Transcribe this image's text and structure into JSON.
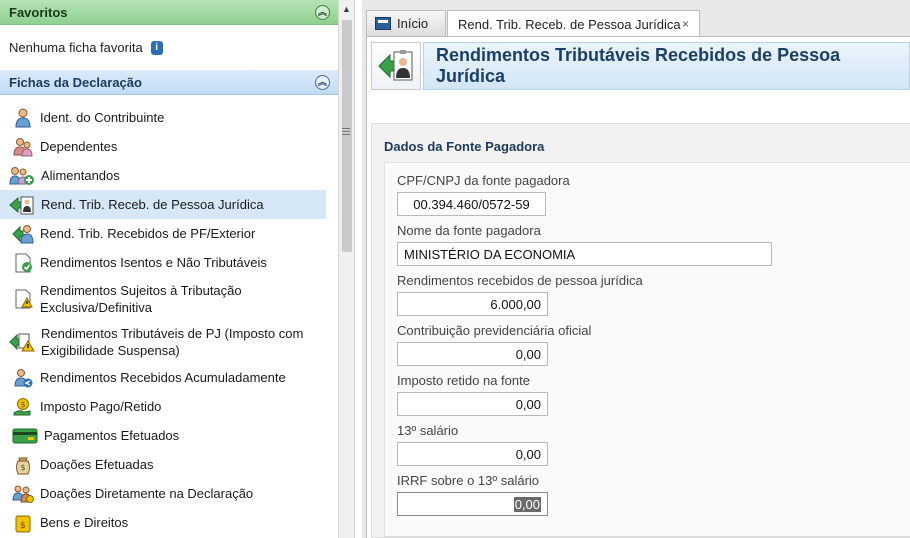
{
  "sidebar": {
    "favorites_title": "Favoritos",
    "favorites_empty": "Nenhuma ficha favorita",
    "fichas_title": "Fichas da Declaração",
    "items": [
      {
        "label": "Ident. do Contribuinte",
        "icon": "person-icon"
      },
      {
        "label": "Dependentes",
        "icon": "dependents-icon"
      },
      {
        "label": "Alimentandos",
        "icon": "alimentandos-icon"
      },
      {
        "label": "Rend. Trib. Receb. de Pessoa Jurídica",
        "icon": "rend-pj-icon"
      },
      {
        "label": "Rend. Trib. Recebidos de PF/Exterior",
        "icon": "rend-pf-icon"
      },
      {
        "label": "Rendimentos Isentos e Não Tributáveis",
        "icon": "isentos-icon"
      },
      {
        "label": "Rendimentos Sujeitos à Tributação Exclusiva/Definitiva",
        "icon": "exclusiva-icon"
      },
      {
        "label": "Rendimentos Tributáveis de PJ (Imposto com Exigibilidade Suspensa)",
        "icon": "suspensa-icon"
      },
      {
        "label": "Rendimentos Recebidos Acumuladamente",
        "icon": "acumulados-icon"
      },
      {
        "label": "Imposto Pago/Retido",
        "icon": "imposto-pago-icon"
      },
      {
        "label": "Pagamentos Efetuados",
        "icon": "payment-card-icon"
      },
      {
        "label": "Doações Efetuadas",
        "icon": "donation-icon"
      },
      {
        "label": "Doações Diretamente na Declaração",
        "icon": "donation-direct-icon"
      },
      {
        "label": "Bens e Direitos",
        "icon": "bens-icon"
      }
    ]
  },
  "tabs": {
    "home_label": "Início",
    "active_label": "Rend. Trib. Receb. de Pessoa Jurídica",
    "close_glyph": "×"
  },
  "page": {
    "title": "Rendimentos Tributáveis Recebidos de Pessoa Jurídica",
    "section_title": "Dados da Fonte Pagadora"
  },
  "form": {
    "cnpj_label": "CPF/CNPJ da fonte pagadora",
    "cnpj_value": "00.394.460/0572-59",
    "nome_label": "Nome da fonte pagadora",
    "nome_value": "MINISTÉRIO DA ECONOMIA",
    "rend_label": "Rendimentos recebidos de pessoa jurídica",
    "rend_value": "6.000,00",
    "contrib_label": "Contribuição previdenciária oficial",
    "contrib_value": "0,00",
    "imposto_label": "Imposto retido na fonte",
    "imposto_value": "0,00",
    "decimo_label": "13º salário",
    "decimo_value": "0,00",
    "irrf_label": "IRRF sobre o 13º salário",
    "irrf_value": "0,00"
  },
  "colors": {
    "favorites_header": "#8fd08f",
    "fichas_header": "#c3dbf3",
    "selected_item": "#d6e8f7",
    "title_text": "#1c3f66"
  }
}
